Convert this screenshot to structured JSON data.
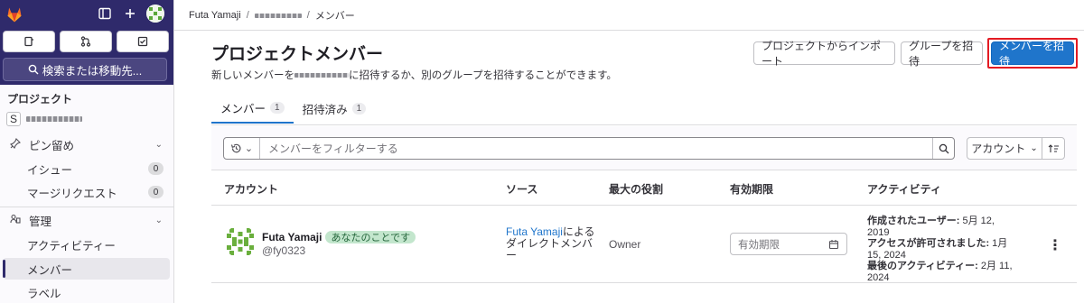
{
  "sidebar": {
    "section_title": "プロジェクト",
    "project_initial": "S",
    "search_label": "検索または移動先...",
    "items": [
      {
        "label": "ピン留め",
        "icon": "pin-icon"
      },
      {
        "label": "イシュー",
        "count": "0"
      },
      {
        "label": "マージリクエスト",
        "count": "0"
      },
      {
        "label": "管理",
        "icon": "manage-icon"
      },
      {
        "label": "アクティビティー"
      },
      {
        "label": "メンバー"
      },
      {
        "label": "ラベル"
      }
    ]
  },
  "breadcrumb": {
    "user": "Futa Yamaji",
    "current": "メンバー"
  },
  "page": {
    "title": "プロジェクトメンバー",
    "subtitle_pre": "新しいメンバーを",
    "subtitle_post": "に招待するか、別のグループを招待することができます。"
  },
  "buttons": {
    "import": "プロジェクトからインポート",
    "invite_group": "グループを招待",
    "invite_members": "メンバーを招待"
  },
  "tabs": [
    {
      "label": "メンバー",
      "count": "1"
    },
    {
      "label": "招待済み",
      "count": "1"
    }
  ],
  "filter": {
    "placeholder": "メンバーをフィルターする",
    "sort_label": "アカウント"
  },
  "table": {
    "headers": [
      "アカウント",
      "ソース",
      "最大の役割",
      "有効期限",
      "アクティビティ"
    ]
  },
  "member": {
    "name": "Futa Yamaji",
    "badge": "あなたのことです",
    "username": "@fy0323",
    "source_link": "Futa Yamaji",
    "source_rest": "によるダイレクトメンバー",
    "role": "Owner",
    "expiry_placeholder": "有効期限",
    "activity": [
      {
        "label": "作成されたユーザー:",
        "value": " 5月 12, 2019"
      },
      {
        "label": "アクセスが許可されました:",
        "value": " 1月 15, 2024"
      },
      {
        "label": "最後のアクティビティー:",
        "value": " 2月 11, 2024"
      }
    ]
  },
  "colors": {
    "sidebar_top": "#2f2a6b",
    "primary": "#1f75cb",
    "highlight": "#e31b23",
    "badge_green": "#c3e6cd"
  }
}
